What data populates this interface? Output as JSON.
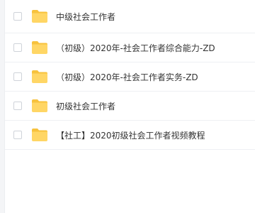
{
  "file_list": {
    "items": [
      {
        "name": "中级社会工作者",
        "icon": "folder-icon"
      },
      {
        "name": "（初级）2020年-社会工作者综合能力-ZD",
        "icon": "folder-icon"
      },
      {
        "name": "（初级）2020年-社会工作者实务-ZD",
        "icon": "folder-icon"
      },
      {
        "name": "初级社会工作者",
        "icon": "folder-icon"
      },
      {
        "name": "【社工】2020初级社会工作者视频教程",
        "icon": "folder-icon"
      }
    ]
  },
  "colors": {
    "folder_body": "#FFD665",
    "folder_tab": "#F7C23D",
    "row_divider": "#EEF0F3",
    "text": "#333333"
  }
}
